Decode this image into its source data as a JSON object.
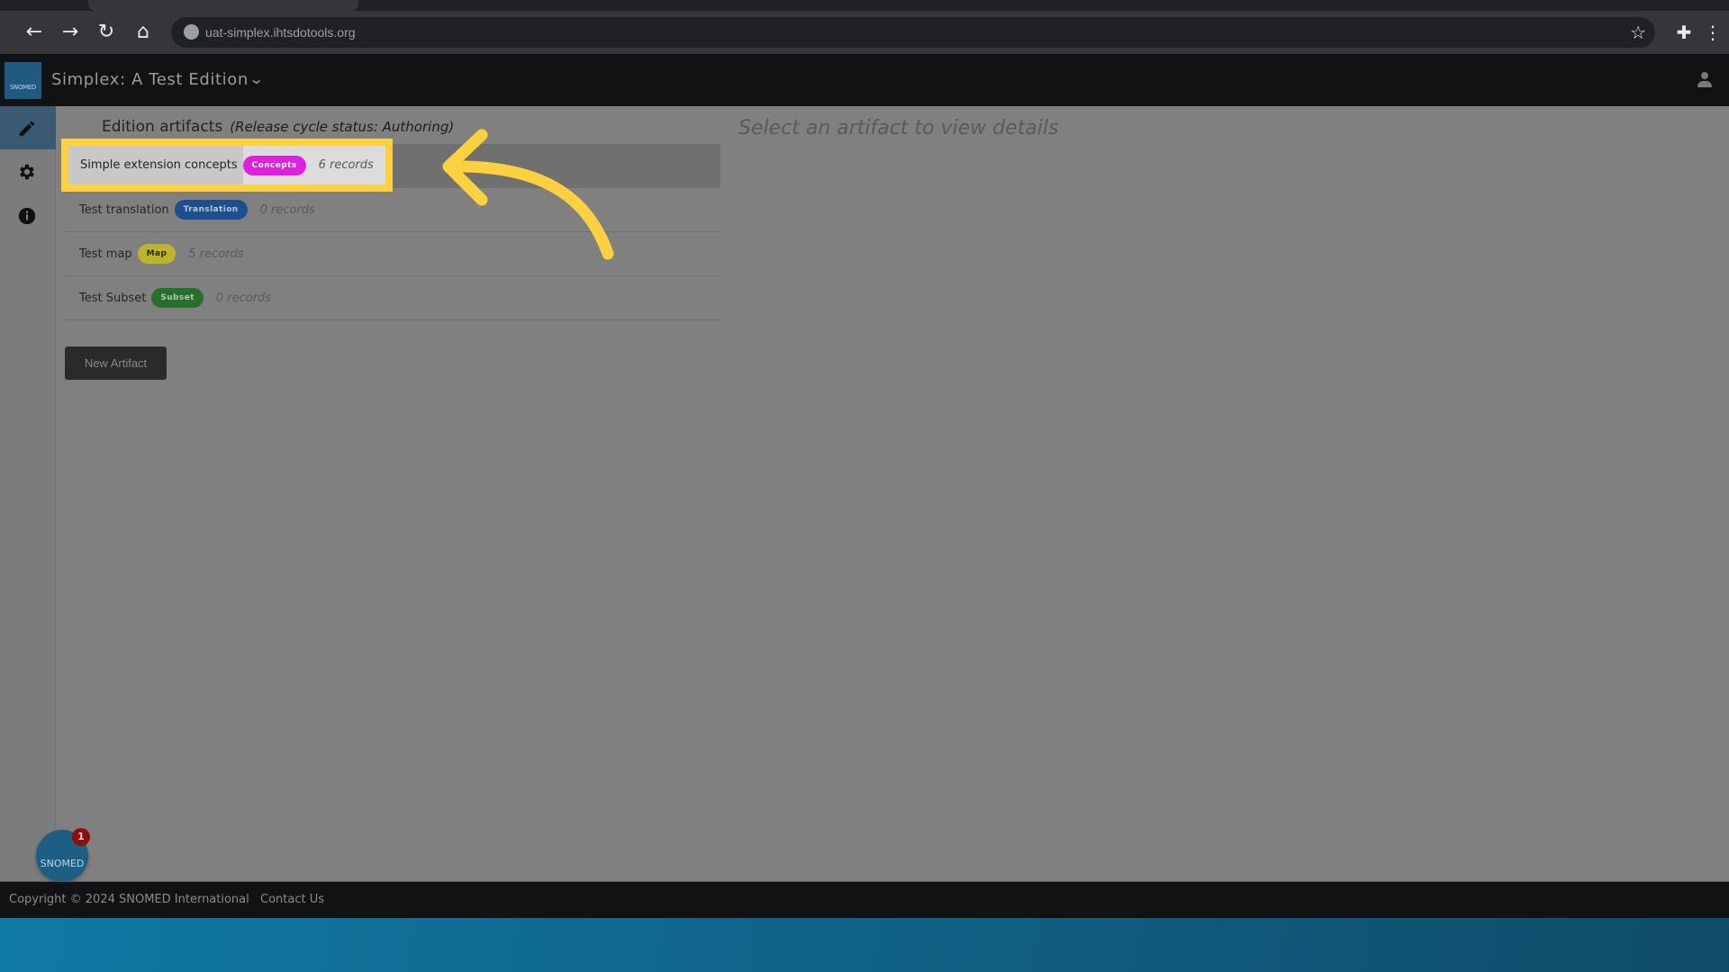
{
  "browser": {
    "url": "uat-simplex.ihtsdotools.org",
    "nav_icons": [
      "back-arrow-icon",
      "forward-arrow-icon",
      "reload-icon",
      "home-icon"
    ],
    "right_icons": [
      "bookmark-star-icon",
      "extensions-icon",
      "kebab-menu-icon"
    ]
  },
  "app": {
    "logo_text": "SNOMED",
    "title": "Simplex: A Test Edition",
    "title_chevron": "⌄"
  },
  "sidebar": {
    "items": [
      {
        "name": "edit",
        "icon": "pencil-icon",
        "active": true
      },
      {
        "name": "settings",
        "icon": "gear-icon",
        "active": false
      },
      {
        "name": "info",
        "icon": "info-icon",
        "active": false
      }
    ]
  },
  "main": {
    "section_title": "Edition artifacts",
    "release_status": "(Release cycle status: Authoring)",
    "artifacts": [
      {
        "name": "Simple extension concepts",
        "badge": "Concepts",
        "badge_color": "#e020e0",
        "badge_text_color": "#ffffff",
        "records": "6 records",
        "selected": true
      },
      {
        "name": "Test translation",
        "badge": "Translation",
        "badge_color": "#1d4f8c",
        "badge_text_color": "#b8c8e0",
        "records": "0 records",
        "selected": false
      },
      {
        "name": "Test map",
        "badge": "Map",
        "badge_color": "#bcb52c",
        "badge_text_color": "#2a2a10",
        "records": "5 records",
        "selected": false
      },
      {
        "name": "Test Subset",
        "badge": "Subset",
        "badge_color": "#2a6e2e",
        "badge_text_color": "#b0c8b0",
        "records": "0 records",
        "selected": false
      }
    ],
    "new_artifact_label": "New Artifact",
    "details_placeholder": "Select an artifact to view details"
  },
  "annotation": {
    "highlight_color": "#ffd040",
    "arrow_color": "#ffd040"
  },
  "chat": {
    "label": "SNOMED",
    "unread_count": "1"
  },
  "footer": {
    "copyright": "Copyright © 2024 SNOMED International",
    "contact": "Contact Us"
  }
}
